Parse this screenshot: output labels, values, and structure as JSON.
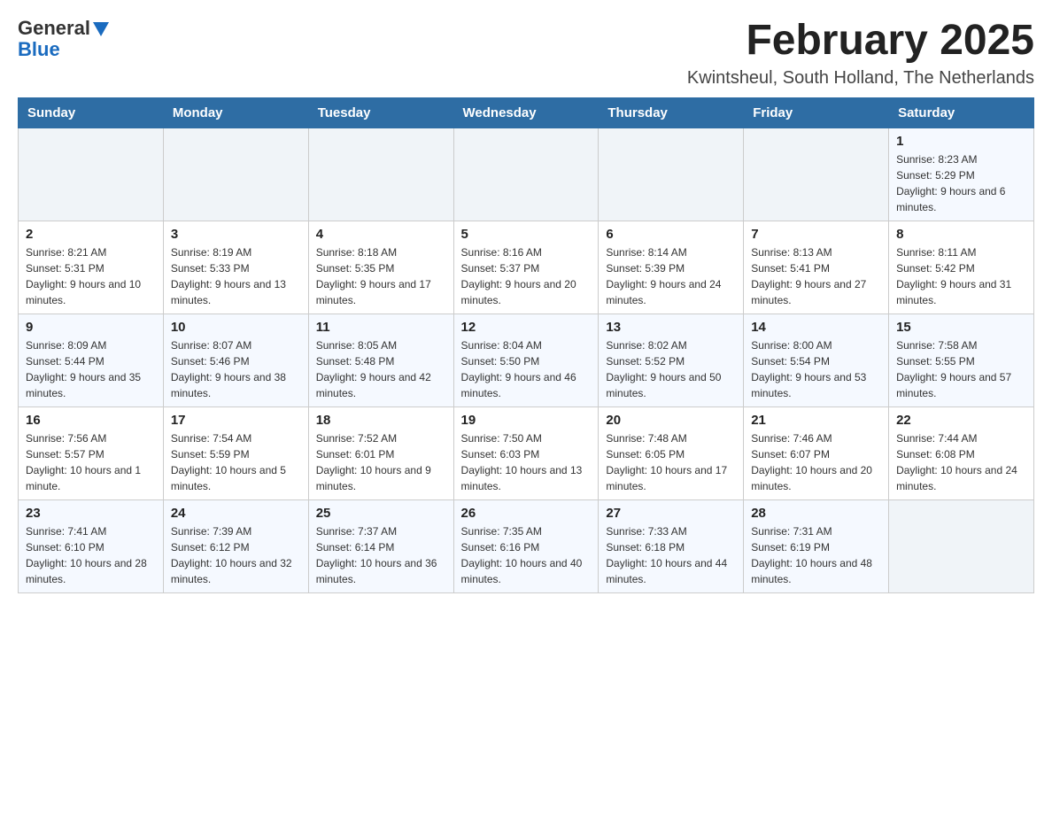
{
  "logo": {
    "text_general": "General",
    "text_blue": "Blue"
  },
  "title": {
    "month_year": "February 2025",
    "location": "Kwintsheul, South Holland, The Netherlands"
  },
  "calendar": {
    "headers": [
      "Sunday",
      "Monday",
      "Tuesday",
      "Wednesday",
      "Thursday",
      "Friday",
      "Saturday"
    ],
    "weeks": [
      [
        {
          "day": "",
          "info": ""
        },
        {
          "day": "",
          "info": ""
        },
        {
          "day": "",
          "info": ""
        },
        {
          "day": "",
          "info": ""
        },
        {
          "day": "",
          "info": ""
        },
        {
          "day": "",
          "info": ""
        },
        {
          "day": "1",
          "info": "Sunrise: 8:23 AM\nSunset: 5:29 PM\nDaylight: 9 hours and 6 minutes."
        }
      ],
      [
        {
          "day": "2",
          "info": "Sunrise: 8:21 AM\nSunset: 5:31 PM\nDaylight: 9 hours and 10 minutes."
        },
        {
          "day": "3",
          "info": "Sunrise: 8:19 AM\nSunset: 5:33 PM\nDaylight: 9 hours and 13 minutes."
        },
        {
          "day": "4",
          "info": "Sunrise: 8:18 AM\nSunset: 5:35 PM\nDaylight: 9 hours and 17 minutes."
        },
        {
          "day": "5",
          "info": "Sunrise: 8:16 AM\nSunset: 5:37 PM\nDaylight: 9 hours and 20 minutes."
        },
        {
          "day": "6",
          "info": "Sunrise: 8:14 AM\nSunset: 5:39 PM\nDaylight: 9 hours and 24 minutes."
        },
        {
          "day": "7",
          "info": "Sunrise: 8:13 AM\nSunset: 5:41 PM\nDaylight: 9 hours and 27 minutes."
        },
        {
          "day": "8",
          "info": "Sunrise: 8:11 AM\nSunset: 5:42 PM\nDaylight: 9 hours and 31 minutes."
        }
      ],
      [
        {
          "day": "9",
          "info": "Sunrise: 8:09 AM\nSunset: 5:44 PM\nDaylight: 9 hours and 35 minutes."
        },
        {
          "day": "10",
          "info": "Sunrise: 8:07 AM\nSunset: 5:46 PM\nDaylight: 9 hours and 38 minutes."
        },
        {
          "day": "11",
          "info": "Sunrise: 8:05 AM\nSunset: 5:48 PM\nDaylight: 9 hours and 42 minutes."
        },
        {
          "day": "12",
          "info": "Sunrise: 8:04 AM\nSunset: 5:50 PM\nDaylight: 9 hours and 46 minutes."
        },
        {
          "day": "13",
          "info": "Sunrise: 8:02 AM\nSunset: 5:52 PM\nDaylight: 9 hours and 50 minutes."
        },
        {
          "day": "14",
          "info": "Sunrise: 8:00 AM\nSunset: 5:54 PM\nDaylight: 9 hours and 53 minutes."
        },
        {
          "day": "15",
          "info": "Sunrise: 7:58 AM\nSunset: 5:55 PM\nDaylight: 9 hours and 57 minutes."
        }
      ],
      [
        {
          "day": "16",
          "info": "Sunrise: 7:56 AM\nSunset: 5:57 PM\nDaylight: 10 hours and 1 minute."
        },
        {
          "day": "17",
          "info": "Sunrise: 7:54 AM\nSunset: 5:59 PM\nDaylight: 10 hours and 5 minutes."
        },
        {
          "day": "18",
          "info": "Sunrise: 7:52 AM\nSunset: 6:01 PM\nDaylight: 10 hours and 9 minutes."
        },
        {
          "day": "19",
          "info": "Sunrise: 7:50 AM\nSunset: 6:03 PM\nDaylight: 10 hours and 13 minutes."
        },
        {
          "day": "20",
          "info": "Sunrise: 7:48 AM\nSunset: 6:05 PM\nDaylight: 10 hours and 17 minutes."
        },
        {
          "day": "21",
          "info": "Sunrise: 7:46 AM\nSunset: 6:07 PM\nDaylight: 10 hours and 20 minutes."
        },
        {
          "day": "22",
          "info": "Sunrise: 7:44 AM\nSunset: 6:08 PM\nDaylight: 10 hours and 24 minutes."
        }
      ],
      [
        {
          "day": "23",
          "info": "Sunrise: 7:41 AM\nSunset: 6:10 PM\nDaylight: 10 hours and 28 minutes."
        },
        {
          "day": "24",
          "info": "Sunrise: 7:39 AM\nSunset: 6:12 PM\nDaylight: 10 hours and 32 minutes."
        },
        {
          "day": "25",
          "info": "Sunrise: 7:37 AM\nSunset: 6:14 PM\nDaylight: 10 hours and 36 minutes."
        },
        {
          "day": "26",
          "info": "Sunrise: 7:35 AM\nSunset: 6:16 PM\nDaylight: 10 hours and 40 minutes."
        },
        {
          "day": "27",
          "info": "Sunrise: 7:33 AM\nSunset: 6:18 PM\nDaylight: 10 hours and 44 minutes."
        },
        {
          "day": "28",
          "info": "Sunrise: 7:31 AM\nSunset: 6:19 PM\nDaylight: 10 hours and 48 minutes."
        },
        {
          "day": "",
          "info": ""
        }
      ]
    ]
  }
}
